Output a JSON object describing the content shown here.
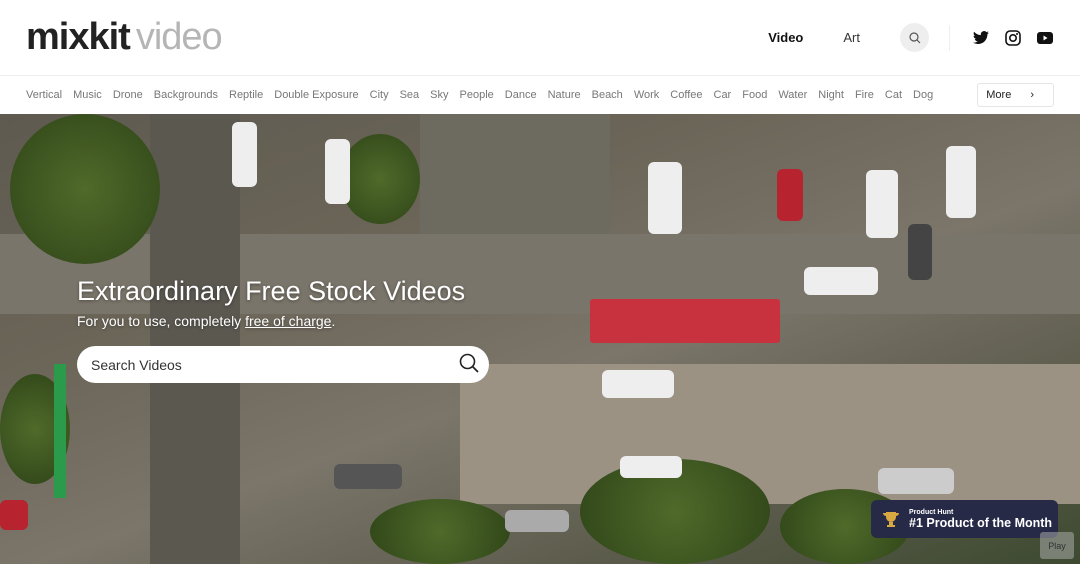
{
  "header": {
    "logo_bold": "mixkit",
    "logo_light": "video",
    "nav": [
      {
        "label": "Video",
        "active": true
      },
      {
        "label": "Art",
        "active": false
      }
    ],
    "icons": [
      "search-icon",
      "twitter-icon",
      "instagram-icon",
      "youtube-icon"
    ]
  },
  "categories": [
    "Vertical",
    "Music",
    "Drone",
    "Backgrounds",
    "Reptile",
    "Double Exposure",
    "City",
    "Sea",
    "Sky",
    "People",
    "Dance",
    "Nature",
    "Beach",
    "Work",
    "Coffee",
    "Car",
    "Food",
    "Water",
    "Night",
    "Fire",
    "Cat",
    "Dog"
  ],
  "more_label": "More",
  "hero": {
    "title": "Extraordinary Free Stock Videos",
    "subtitle_prefix": "For you to use, completely ",
    "subtitle_link": "free of charge",
    "subtitle_suffix": ".",
    "search_placeholder": "Search Videos"
  },
  "badge": {
    "label": "Product Hunt",
    "title": "#1 Product of the Month",
    "color": "#262a47"
  },
  "play_label": "Play"
}
